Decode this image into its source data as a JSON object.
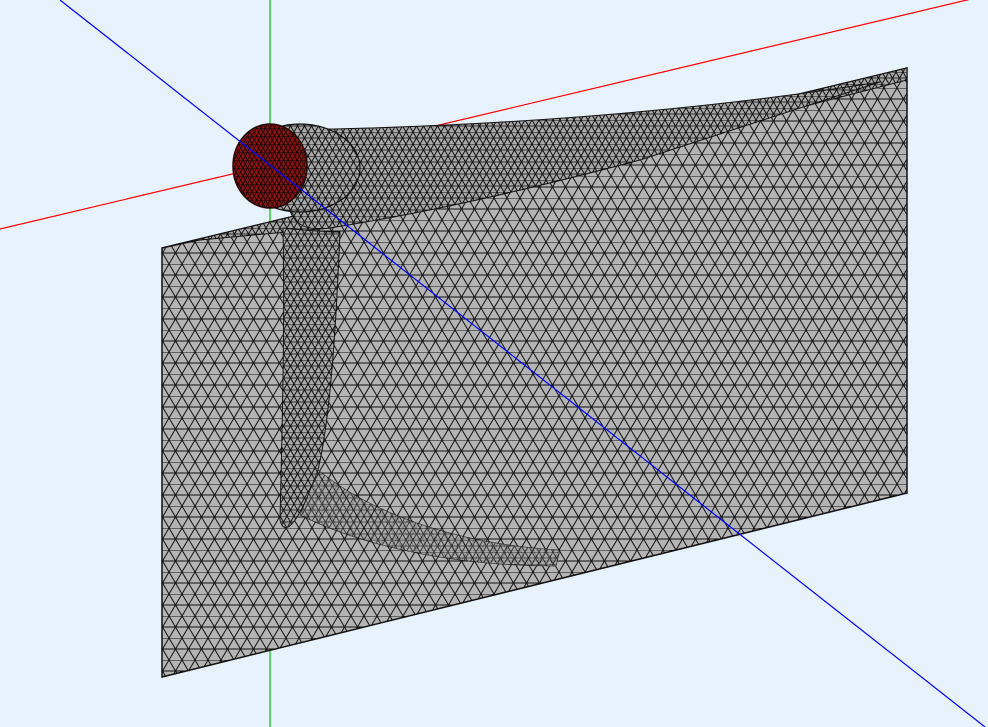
{
  "viewport": {
    "background_color": "#e8f2fc",
    "axis_colors": {
      "x_axis": "#ff0000",
      "y_axis": "#00c000",
      "z_axis": "#0000ff"
    },
    "mesh_fill_color": "#b4b4b4",
    "mesh_edge_color": "#111111",
    "port_face_color": "#8a1414",
    "element_type": "triangle"
  }
}
